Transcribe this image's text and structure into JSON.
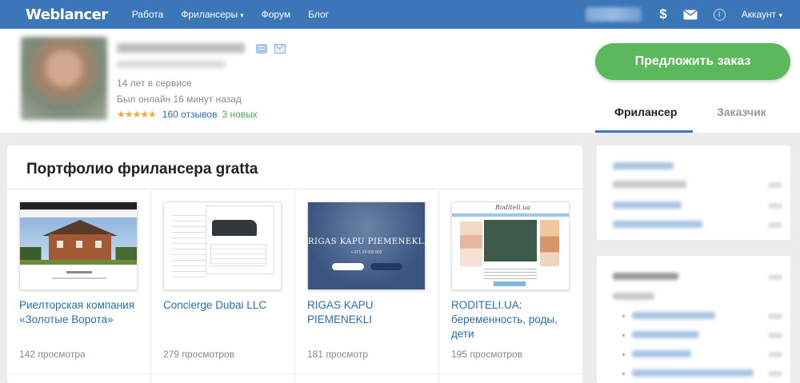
{
  "nav": {
    "logo": "Weblancer",
    "links": [
      {
        "label": "Работа",
        "has_caret": false
      },
      {
        "label": "Фрилансеры",
        "has_caret": true
      },
      {
        "label": "Форум",
        "has_caret": false
      },
      {
        "label": "Блог",
        "has_caret": false
      }
    ],
    "caret": "▾",
    "icons": [
      "dollar-icon",
      "mail-icon",
      "info-icon"
    ],
    "dollar_glyph": "$",
    "info_glyph": "i",
    "account_label": "Аккаунт",
    "account_caret": "▾"
  },
  "profile": {
    "years_in_service": "14 лет в сервисе",
    "last_online": "Был онлайн 16 минут назад",
    "stars": "★★★★★",
    "rating": 5,
    "reviews": "160 отзывов",
    "new_reviews": "3 новых",
    "offer_button": "Предложить заказ",
    "tabs": {
      "freelancer": "Фрилансер",
      "customer": "Заказчик"
    }
  },
  "portfolio": {
    "title": "Портфолио фрилансера gratta",
    "cards": [
      {
        "title": "Риелторская компания «Золотые Ворота»",
        "views": "142 просмотра"
      },
      {
        "title": "Concierge Dubai LLC",
        "views": "279 просмотров"
      },
      {
        "title": "RIGAS KAPU PIEMENEKLI",
        "views": "181 просмотр"
      },
      {
        "title": "RODITELI.UA: беременность, роды, дети",
        "views": "195 просмотров"
      }
    ],
    "thumb3": {
      "title": "RIGAS KAPU PIEMENEKLI",
      "phone": "+ 371 24 002 002"
    },
    "thumb4": {
      "logo": "Roditeli.ua"
    }
  },
  "colors": {
    "nav_bg": "#3a76b8",
    "accent_green": "#5cb85c",
    "link_blue": "#2a6fb4",
    "star_orange": "#f0a830",
    "new_green": "#4cae4c"
  }
}
